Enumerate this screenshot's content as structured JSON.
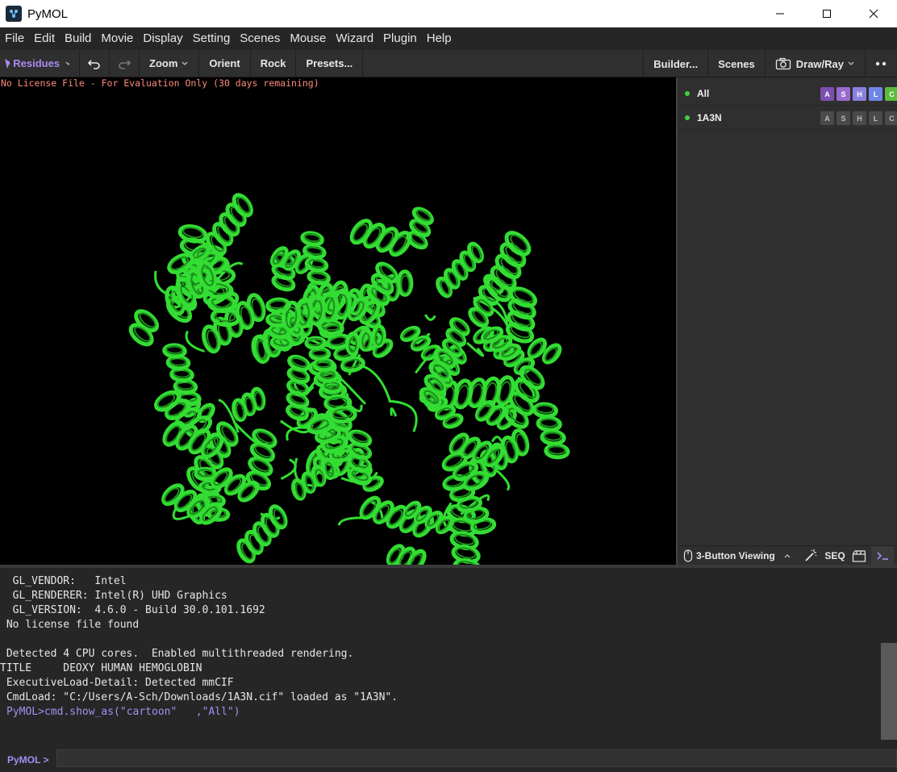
{
  "window": {
    "title": "PyMOL",
    "controls": [
      "minimize",
      "maximize",
      "close"
    ]
  },
  "menu": [
    "File",
    "Edit",
    "Build",
    "Movie",
    "Display",
    "Setting",
    "Scenes",
    "Mouse",
    "Wizard",
    "Plugin",
    "Help"
  ],
  "toolbar": {
    "selection_mode": "Residues",
    "zoom": "Zoom",
    "orient": "Orient",
    "rock": "Rock",
    "presets": "Presets...",
    "builder": "Builder...",
    "scenes": "Scenes",
    "draw_ray": "Draw/Ray"
  },
  "viewport": {
    "license_notice": "No License File - For Evaluation Only (30 days remaining)",
    "background_color": "#000000",
    "cartoon_color": "#33dd33"
  },
  "objects": [
    {
      "name": "All",
      "buttons": [
        "A",
        "S",
        "H",
        "L",
        "C"
      ],
      "colored": true
    },
    {
      "name": "1A3N",
      "buttons": [
        "A",
        "S",
        "H",
        "L",
        "C"
      ],
      "colored": false
    }
  ],
  "panel_bottom": {
    "mouse_mode": "3-Button Viewing",
    "seq": "SEQ"
  },
  "console": {
    "lines": [
      "  GL_VENDOR:   Intel",
      "  GL_RENDERER: Intel(R) UHD Graphics",
      "  GL_VERSION:  4.6.0 - Build 30.0.101.1692",
      " No license file found",
      "",
      " Detected 4 CPU cores.  Enabled multithreaded rendering.",
      "TITLE     DEOXY HUMAN HEMOGLOBIN",
      " ExecutiveLoad-Detail: Detected mmCIF",
      " CmdLoad: \"C:/Users/A-Sch/Downloads/1A3N.cif\" loaded as \"1A3N\"."
    ],
    "last_command": "PyMOL>cmd.show_as(\"cartoon\"   ,\"All\")"
  },
  "prompt": {
    "label": "PyMOL >",
    "value": ""
  }
}
